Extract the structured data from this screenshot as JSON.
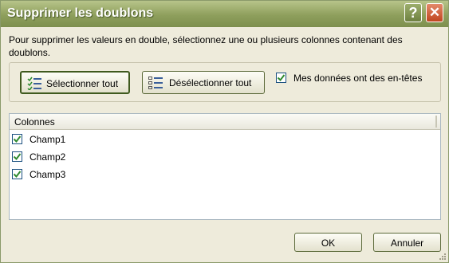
{
  "window": {
    "title": "Supprimer les doublons",
    "help_label": "?",
    "close_label": "✕"
  },
  "description": "Pour supprimer les valeurs en double, sélectionnez une ou plusieurs colonnes contenant des doublons.",
  "toolbar": {
    "select_all_label": "Sélectionner tout",
    "deselect_all_label": "Désélectionner tout",
    "has_headers_label": "Mes données ont des en-têtes",
    "has_headers_checked": true
  },
  "columns_list": {
    "header": "Colonnes",
    "items": [
      {
        "label": "Champ1",
        "checked": true
      },
      {
        "label": "Champ2",
        "checked": true
      },
      {
        "label": "Champ3",
        "checked": true
      }
    ]
  },
  "footer": {
    "ok_label": "OK",
    "cancel_label": "Annuler"
  },
  "colors": {
    "titlebar": "#8e9f5c",
    "background": "#eeebdb",
    "checkmark": "#2f8a2f",
    "close": "#c0451f"
  },
  "icons": [
    "help-icon",
    "close-icon",
    "select-all-icon",
    "deselect-all-icon",
    "checkbox-checked-icon",
    "resize-grip-icon"
  ]
}
